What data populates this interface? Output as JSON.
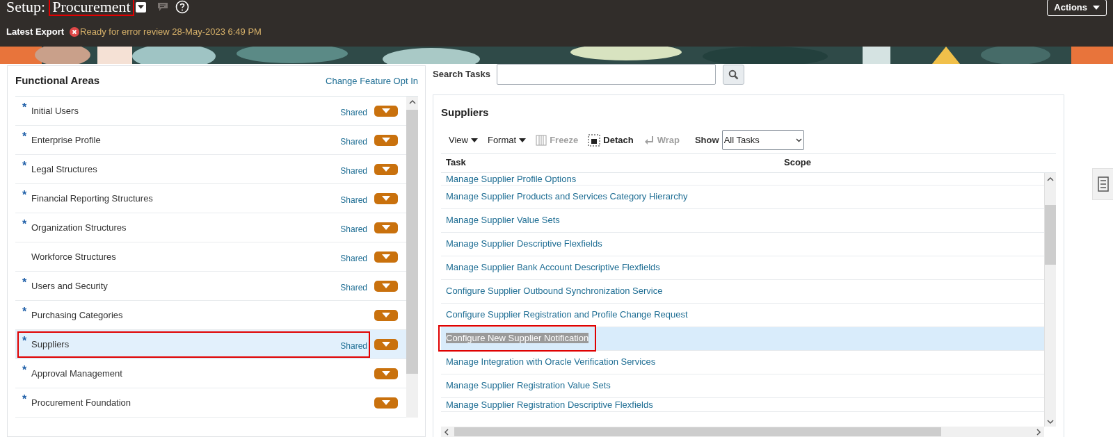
{
  "header": {
    "title_prefix": "Setup:",
    "title": "Procurement",
    "title_annotated": true,
    "actions": "Actions",
    "export_label": "Latest Export",
    "export_status": "Ready for error review 28-May-2023 6:49 PM"
  },
  "functional_areas": {
    "heading": "Functional Areas",
    "link": "Change Feature Opt In",
    "rows": [
      {
        "label": "Initial Users",
        "marker": "*",
        "shared": "Shared",
        "selected": false,
        "annotated": false
      },
      {
        "label": "Enterprise Profile",
        "marker": "*",
        "shared": "Shared",
        "selected": false,
        "annotated": false
      },
      {
        "label": "Legal Structures",
        "marker": "*",
        "shared": "Shared",
        "selected": false,
        "annotated": false
      },
      {
        "label": "Financial Reporting Structures",
        "marker": "*",
        "shared": "Shared",
        "selected": false,
        "annotated": false
      },
      {
        "label": "Organization Structures",
        "marker": "*",
        "shared": "Shared",
        "selected": false,
        "annotated": false
      },
      {
        "label": "Workforce Structures",
        "shared": "Shared",
        "selected": false,
        "annotated": false
      },
      {
        "label": "Users and Security",
        "marker": "*",
        "shared": "Shared",
        "selected": false,
        "annotated": false
      },
      {
        "label": "Purchasing Categories",
        "marker": "*",
        "selected": false,
        "annotated": false
      },
      {
        "label": "Suppliers",
        "marker": "*",
        "shared": "Shared",
        "selected": true,
        "annotated": true
      },
      {
        "label": "Approval Management",
        "marker": "*",
        "selected": false,
        "annotated": false
      },
      {
        "label": "Procurement Foundation",
        "marker": "*",
        "selected": false,
        "annotated": false
      }
    ]
  },
  "search": {
    "label": "Search Tasks"
  },
  "tasks_panel": {
    "title": "Suppliers",
    "toolbar": [
      {
        "label": "View",
        "kind": "menu",
        "disabled": false
      },
      {
        "label": "Format",
        "kind": "menu",
        "disabled": false
      },
      {
        "label": "Freeze",
        "kind": "freeze",
        "disabled": true
      },
      {
        "label": "Detach",
        "kind": "detach",
        "disabled": false
      },
      {
        "label": "Wrap",
        "kind": "wrap",
        "disabled": true
      }
    ],
    "show_label": "Show",
    "show_value": "All Tasks",
    "columns": [
      "Task",
      "Scope"
    ],
    "rows": [
      {
        "task": "Manage Supplier Profile Options",
        "selected": false,
        "annotated": false
      },
      {
        "task": "Manage Supplier Products and Services Category Hierarchy",
        "selected": false,
        "annotated": false
      },
      {
        "task": "Manage Supplier Value Sets",
        "selected": false,
        "annotated": false
      },
      {
        "task": "Manage Supplier Descriptive Flexfields",
        "selected": false,
        "annotated": false
      },
      {
        "task": "Manage Supplier Bank Account Descriptive Flexfields",
        "selected": false,
        "annotated": false
      },
      {
        "task": "Configure Supplier Outbound Synchronization Service",
        "selected": false,
        "annotated": false
      },
      {
        "task": "Configure Supplier Registration and Profile Change Request",
        "selected": false,
        "annotated": false
      },
      {
        "task": "Configure New Supplier Notification",
        "selected": true,
        "annotated": true
      },
      {
        "task": "Manage Integration with Oracle Verification Services",
        "selected": false,
        "annotated": false
      },
      {
        "task": "Manage Supplier Registration Value Sets",
        "selected": false,
        "annotated": false
      },
      {
        "task": "Manage Supplier Registration Descriptive Flexfields",
        "selected": false,
        "annotated": false
      }
    ]
  }
}
